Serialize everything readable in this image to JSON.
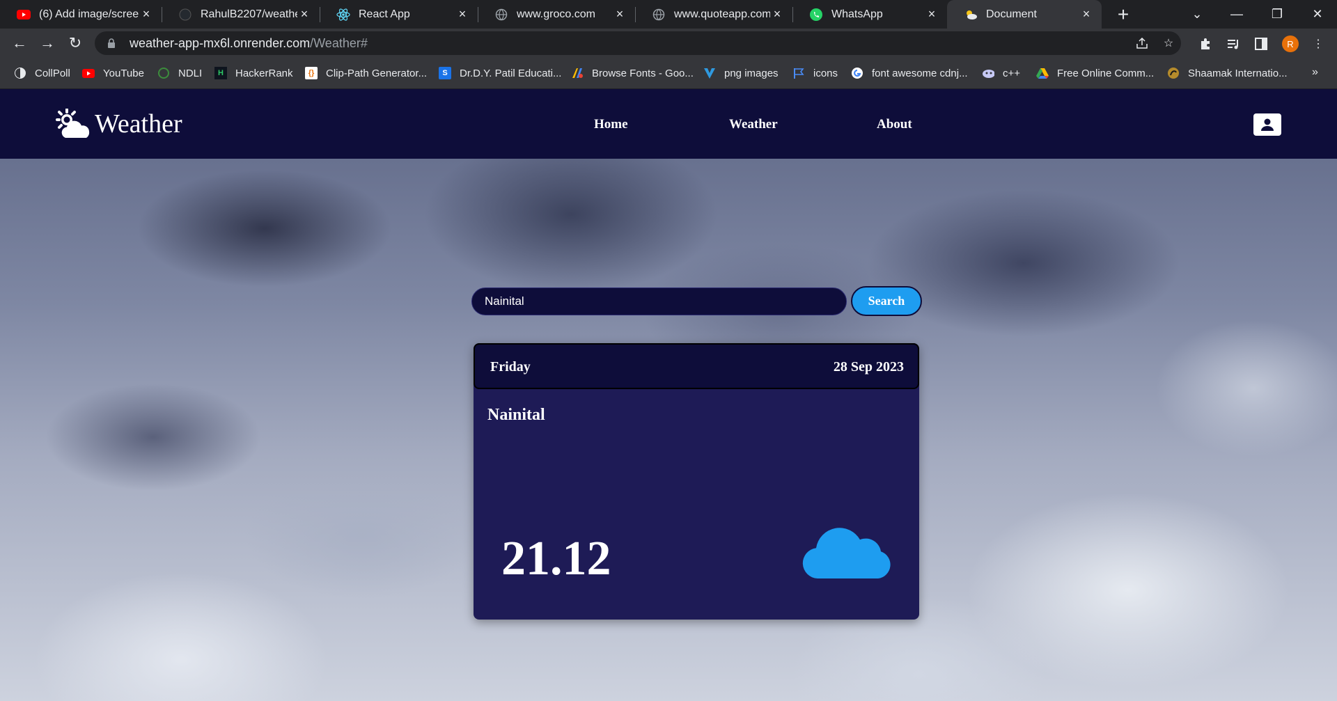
{
  "browser": {
    "tabs": [
      {
        "title": "(6) Add image/screen",
        "icon": "youtube-icon"
      },
      {
        "title": "RahulB2207/weather",
        "icon": "github-icon"
      },
      {
        "title": "React App",
        "icon": "react-icon"
      },
      {
        "title": "www.groco.com",
        "icon": "globe-icon"
      },
      {
        "title": "www.quoteapp.com",
        "icon": "globe-icon"
      },
      {
        "title": "WhatsApp",
        "icon": "whatsapp-icon"
      },
      {
        "title": "Document",
        "icon": "weather-icon"
      }
    ],
    "active_tab": 6,
    "url_host": "weather-app-mx6l.onrender.com",
    "url_path": "/Weather#",
    "profile_initial": "R",
    "bookmarks": [
      {
        "label": "CollPoll",
        "icon": "collpoll-icon"
      },
      {
        "label": "YouTube",
        "icon": "youtube-icon"
      },
      {
        "label": "NDLI",
        "icon": "ndli-icon"
      },
      {
        "label": "HackerRank",
        "icon": "hackerrank-icon"
      },
      {
        "label": "Clip-Path Generator...",
        "icon": "clippath-icon"
      },
      {
        "label": "Dr.D.Y. Patil Educati...",
        "icon": "school-icon"
      },
      {
        "label": "Browse Fonts - Goo...",
        "icon": "google-fonts-icon"
      },
      {
        "label": "png images",
        "icon": "png-icon"
      },
      {
        "label": "icons",
        "icon": "flag-icon"
      },
      {
        "label": "font awesome cdnj...",
        "icon": "google-icon"
      },
      {
        "label": "c++",
        "icon": "cpp-icon"
      },
      {
        "label": "Free Online Comm...",
        "icon": "drive-icon"
      },
      {
        "label": "Shaamak Internatio...",
        "icon": "shaamak-icon"
      }
    ]
  },
  "app": {
    "logo_text": "Weather",
    "nav": [
      "Home",
      "Weather",
      "About"
    ],
    "search": {
      "value": "Nainital",
      "button": "Search"
    },
    "card": {
      "day": "Friday",
      "date": "28 Sep 2023",
      "city": "Nainital",
      "temperature": "21.12",
      "condition_icon": "cloud-icon"
    },
    "colors": {
      "nav_bg": "#0e0d3a",
      "card_bg": "#1e1b56",
      "accent": "#1e9df0"
    }
  }
}
